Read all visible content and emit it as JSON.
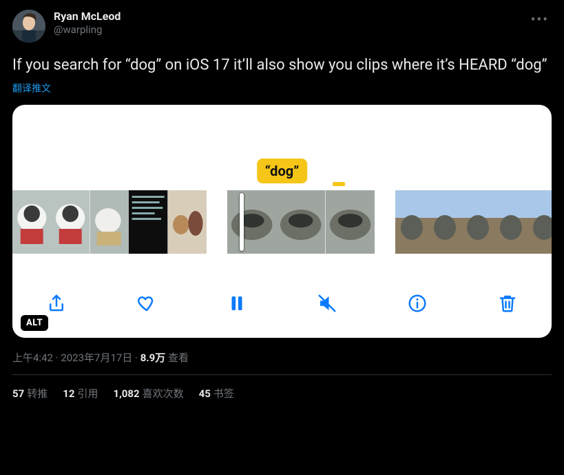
{
  "author": {
    "display_name": "Ryan McLeod",
    "handle": "@warpling"
  },
  "tweet_text": "If you search for “dog” on iOS 17 it’ll also show you clips where it’s HEARD “dog”",
  "translate_label": "翻译推文",
  "media": {
    "caption_chip": "“dog”",
    "alt_badge": "ALT"
  },
  "meta": {
    "time": "上午4:42",
    "date": "2023年7月17日",
    "views_count": "8.9万",
    "views_label": "查看"
  },
  "stats": {
    "retweets": {
      "count": "57",
      "label": "转推"
    },
    "quotes": {
      "count": "12",
      "label": "引用"
    },
    "likes": {
      "count": "1,082",
      "label": "喜欢次数"
    },
    "bookmarks": {
      "count": "45",
      "label": "书签"
    }
  }
}
